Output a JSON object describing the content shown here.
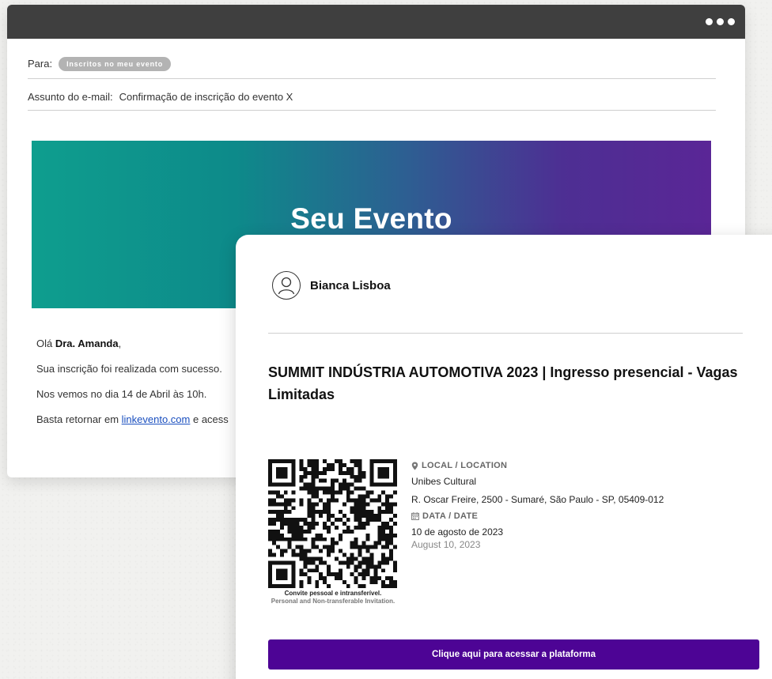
{
  "email": {
    "to_label": "Para:",
    "to_recipient": "Inscritos no meu evento",
    "subject_label": "Assunto do e-mail:",
    "subject_value": "Confirmação de inscrição do evento X",
    "banner_title": "Seu Evento",
    "greeting_prefix": "Olá ",
    "greeting_name": "Dra. Amanda",
    "greeting_suffix": ",",
    "line_1": "Sua inscrição foi realizada com sucesso.",
    "line_2": "Nos vemos no dia 14 de Abril às 10h.",
    "line_3_prefix": "Basta retornar em ",
    "line_3_link": "linkevento.com",
    "line_3_suffix": " e acess"
  },
  "ticket": {
    "user_name": "Bianca Lisboa",
    "event_title": "SUMMIT INDÚSTRIA AUTOMOTIVA 2023 | Ingresso presencial - Vagas Limitadas",
    "qr_caption_pt": "Convite pessoal e intransferível.",
    "qr_caption_en": "Personal and Non-transferable Invitation.",
    "location_heading": "LOCAL / LOCATION",
    "location_name": "Unibes Cultural",
    "location_address": "R. Oscar Freire, 2500 - Sumaré, São Paulo - SP, 05409-012",
    "date_heading": "DATA / DATE",
    "date_pt": "10 de agosto de 2023",
    "date_en": "August 10, 2023",
    "cta_label": "Clique aqui para acessar a plataforma"
  },
  "icons": {
    "window_menu": "more-dots-icon",
    "avatar": "user-icon",
    "location": "map-pin-icon",
    "date": "calendar-icon"
  },
  "colors": {
    "cta": "#4d0495",
    "banner_start": "#0e9e8e",
    "banner_end": "#5a2696",
    "link": "#1a4fbf"
  }
}
